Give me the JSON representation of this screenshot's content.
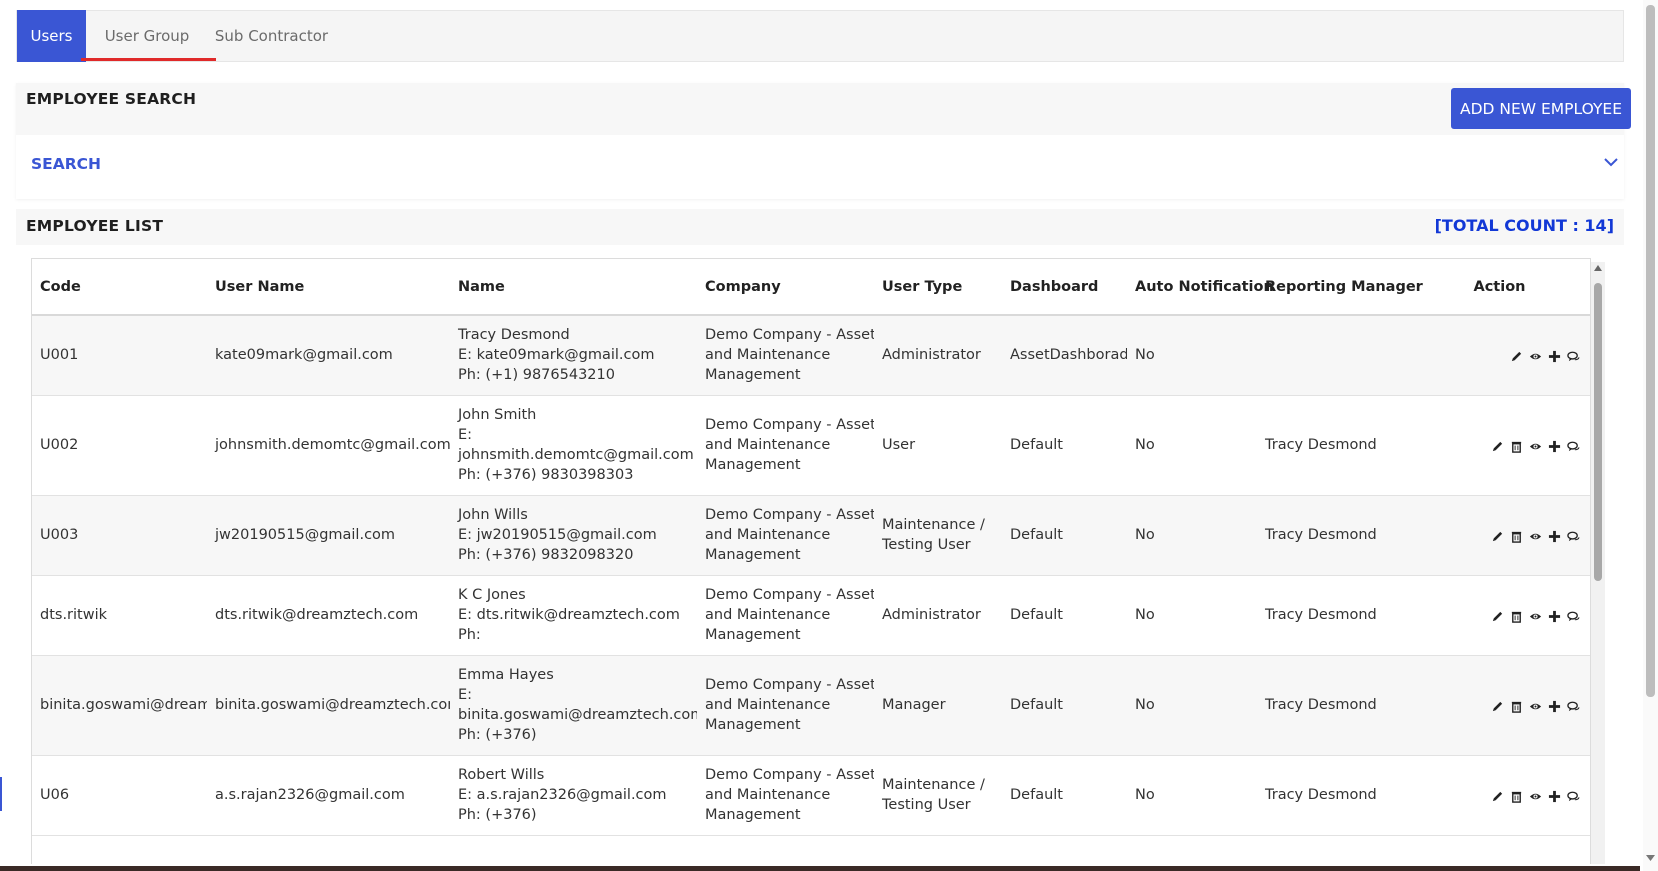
{
  "tabs": [
    {
      "label": "Users",
      "active": true
    },
    {
      "label": "User Group",
      "active": false
    },
    {
      "label": "Sub Contractor",
      "active": false
    }
  ],
  "search_panel": {
    "title": "EMPLOYEE SEARCH",
    "add_button": "ADD NEW EMPLOYEE",
    "search_toggle": "SEARCH"
  },
  "employee_list": {
    "title": "EMPLOYEE LIST",
    "total_count": "[TOTAL COUNT : 14]",
    "columns": [
      "Code",
      "User Name",
      "Name",
      "Company",
      "User Type",
      "Dashboard",
      "Auto Notification",
      "Reporting Manager",
      "Action"
    ],
    "rows": [
      {
        "code": "U001",
        "username": "kate09mark@gmail.com",
        "name_lines": [
          "Tracy Desmond",
          "E: kate09mark@gmail.com",
          "Ph: (+1) 9876543210"
        ],
        "company_lines": [
          "Demo Company - Asset",
          "and Maintenance",
          "Management"
        ],
        "user_type_lines": [
          "Administrator"
        ],
        "dashboard": "AssetDashborad",
        "auto_notification": "No",
        "manager": "",
        "actions": [
          "edit-icon",
          "view-icon",
          "add-icon",
          "comment-icon"
        ]
      },
      {
        "code": "U002",
        "username": "johnsmith.demomtc@gmail.com",
        "name_lines": [
          "John Smith",
          "E:",
          "johnsmith.demomtc@gmail.com",
          "Ph: (+376) 9830398303"
        ],
        "company_lines": [
          "Demo Company - Asset",
          "and Maintenance",
          "Management"
        ],
        "user_type_lines": [
          "User"
        ],
        "dashboard": "Default",
        "auto_notification": "No",
        "manager": "Tracy Desmond",
        "actions": [
          "edit-icon",
          "delete-icon",
          "view-icon",
          "add-icon",
          "comment-icon"
        ]
      },
      {
        "code": "U003",
        "username": "jw20190515@gmail.com",
        "name_lines": [
          "John Wills",
          "E: jw20190515@gmail.com",
          "Ph: (+376) 9832098320"
        ],
        "company_lines": [
          "Demo Company - Asset",
          "and Maintenance",
          "Management"
        ],
        "user_type_lines": [
          "Maintenance /",
          "Testing User"
        ],
        "dashboard": "Default",
        "auto_notification": "No",
        "manager": "Tracy Desmond",
        "actions": [
          "edit-icon",
          "delete-icon",
          "view-icon",
          "add-icon",
          "comment-icon"
        ]
      },
      {
        "code": "dts.ritwik",
        "username": "dts.ritwik@dreamztech.com",
        "name_lines": [
          "K C Jones",
          "E: dts.ritwik@dreamztech.com",
          "Ph:"
        ],
        "company_lines": [
          "Demo Company - Asset",
          "and Maintenance",
          "Management"
        ],
        "user_type_lines": [
          "Administrator"
        ],
        "dashboard": "Default",
        "auto_notification": "No",
        "manager": "Tracy Desmond",
        "actions": [
          "edit-icon",
          "delete-icon",
          "view-icon",
          "add-icon",
          "comment-icon"
        ]
      },
      {
        "code": "binita.goswami@dream",
        "username": "binita.goswami@dreamztech.com",
        "name_lines": [
          "Emma Hayes",
          "E:",
          "binita.goswami@dreamztech.com",
          "Ph: (+376)"
        ],
        "company_lines": [
          "Demo Company - Asset",
          "and Maintenance",
          "Management"
        ],
        "user_type_lines": [
          "Manager"
        ],
        "dashboard": "Default",
        "auto_notification": "No",
        "manager": "Tracy Desmond",
        "actions": [
          "edit-icon",
          "delete-icon",
          "view-icon",
          "add-icon",
          "comment-icon"
        ]
      },
      {
        "code": "U06",
        "username": "a.s.rajan2326@gmail.com",
        "name_lines": [
          "Robert Wills",
          "E: a.s.rajan2326@gmail.com",
          "Ph: (+376)"
        ],
        "company_lines": [
          "Demo Company - Asset",
          "and Maintenance",
          "Management"
        ],
        "user_type_lines": [
          "Maintenance /",
          "Testing User"
        ],
        "dashboard": "Default",
        "auto_notification": "No",
        "manager": "Tracy Desmond",
        "actions": [
          "edit-icon",
          "delete-icon",
          "view-icon",
          "add-icon",
          "comment-icon"
        ]
      }
    ]
  },
  "colors": {
    "accent": "#3a56d4",
    "tab_underline": "#e02a2a",
    "total_count": "#1238d6"
  }
}
